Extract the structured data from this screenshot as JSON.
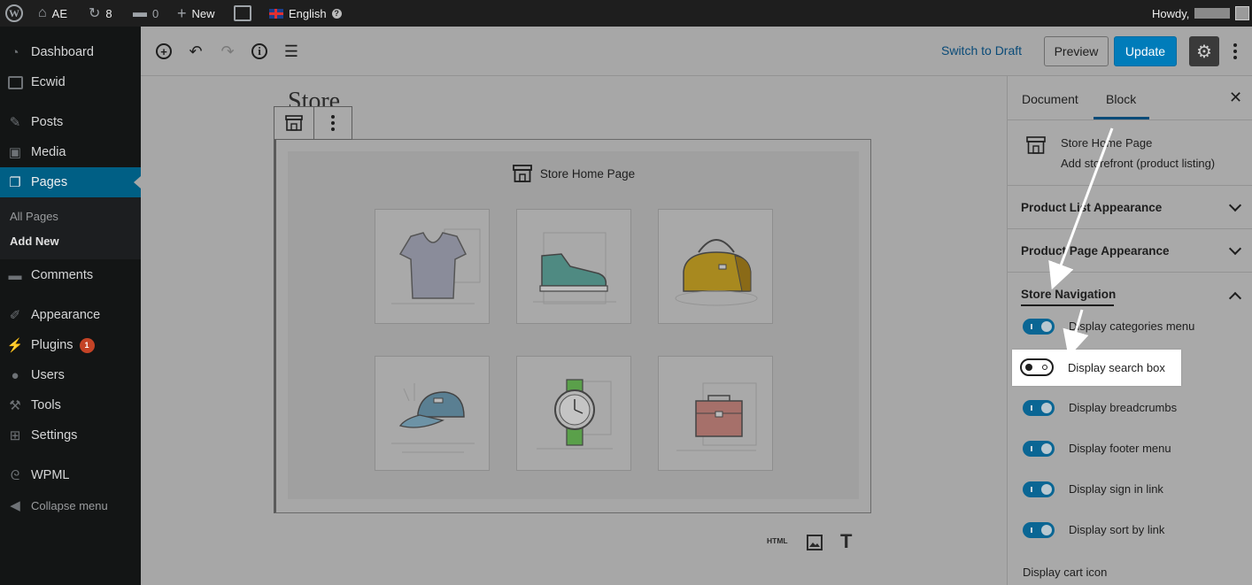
{
  "admin_bar": {
    "site_name": "AE",
    "updates_count": "8",
    "comments_count": "0",
    "new_label": "New",
    "language": "English",
    "howdy": "Howdy,"
  },
  "sidebar": {
    "items": [
      {
        "label": "Dashboard",
        "icon": "dashboard-icon"
      },
      {
        "label": "Ecwid",
        "icon": "ecwid-icon"
      },
      {
        "label": "Posts",
        "icon": "pin-icon"
      },
      {
        "label": "Media",
        "icon": "media-icon"
      },
      {
        "label": "Pages",
        "icon": "pages-icon"
      },
      {
        "label": "Comments",
        "icon": "comment-icon"
      },
      {
        "label": "Appearance",
        "icon": "brush-icon"
      },
      {
        "label": "Plugins",
        "icon": "plug-icon",
        "badge": "1"
      },
      {
        "label": "Users",
        "icon": "user-icon"
      },
      {
        "label": "Tools",
        "icon": "wrench-icon"
      },
      {
        "label": "Settings",
        "icon": "settings-icon"
      },
      {
        "label": "WPML",
        "icon": "wpml-icon"
      },
      {
        "label": "Collapse menu",
        "icon": "collapse-icon"
      }
    ],
    "submenu": [
      "All Pages",
      "Add New"
    ]
  },
  "toolbar": {
    "switch_to_draft": "Switch to Draft",
    "preview": "Preview",
    "update": "Update"
  },
  "editor": {
    "page_title": "Store",
    "block_title": "Store Home Page",
    "html_label": "HTML"
  },
  "panel": {
    "tabs": [
      "Document",
      "Block"
    ],
    "active_tab": "Block",
    "block_name": "Store Home Page",
    "block_desc": "Add storefront (product listing)",
    "sections": {
      "product_list": "Product List Appearance",
      "product_page": "Product Page Appearance",
      "store_nav": "Store Navigation"
    },
    "toggles": [
      {
        "label": "Display categories menu",
        "on": true
      },
      {
        "label": "Display search box",
        "on": false
      },
      {
        "label": "Display breadcrumbs",
        "on": true
      },
      {
        "label": "Display footer menu",
        "on": true
      },
      {
        "label": "Display sign in link",
        "on": true
      },
      {
        "label": "Display sort by link",
        "on": true
      }
    ],
    "cart_icon_label": "Display cart icon"
  },
  "colors": {
    "accent": "#007cba",
    "sidebar_active": "#005f85",
    "toggle_on": "#0a6694",
    "badge": "#c44326"
  }
}
